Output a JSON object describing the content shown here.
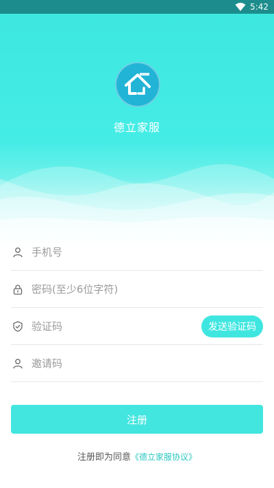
{
  "status_bar": {
    "time": "5:42",
    "wifi_icon": "wifi-icon"
  },
  "header": {
    "app_name": "德立家服",
    "logo_icon": "house-logo-icon",
    "colors": {
      "primary": "#3de8e0",
      "logo_bg": "#22b4d6"
    }
  },
  "form": {
    "phone": {
      "placeholder": "手机号",
      "icon": "user-icon"
    },
    "password": {
      "placeholder": "密码(至少6位字符)",
      "icon": "lock-icon"
    },
    "code": {
      "placeholder": "验证码",
      "icon": "shield-check-icon",
      "send_label": "发送验证码"
    },
    "invite": {
      "placeholder": "邀请码",
      "icon": "user-icon"
    }
  },
  "register_label": "注册",
  "agreement": {
    "prefix": "注册即为同意",
    "link": "《德立家服协议》"
  }
}
